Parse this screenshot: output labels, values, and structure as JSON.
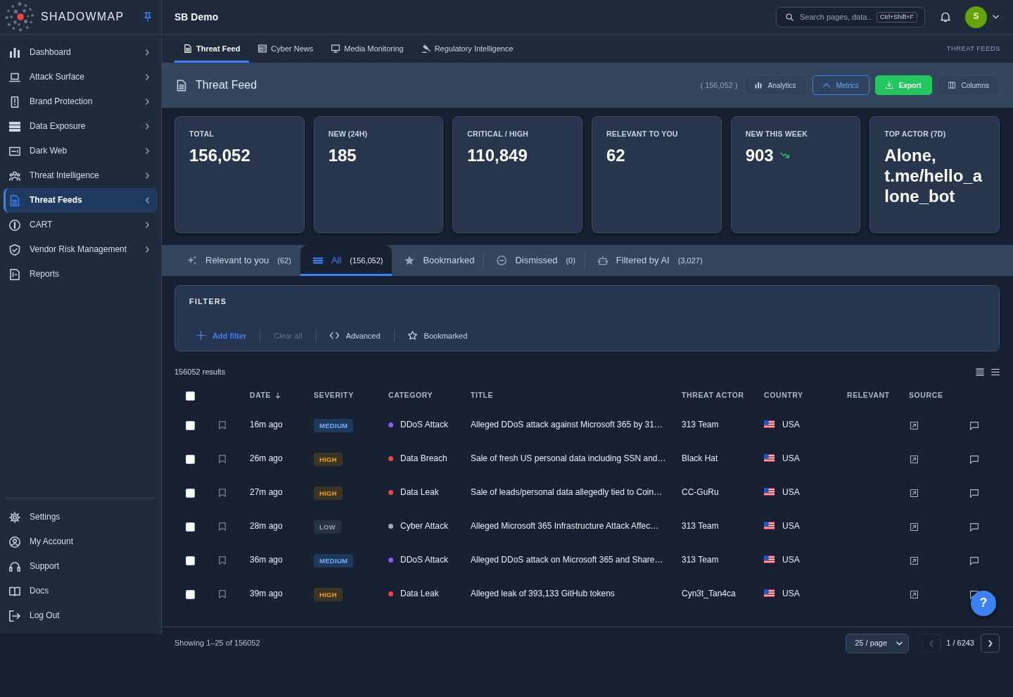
{
  "sidebar": {
    "brand": "SHADOWMAP",
    "items": [
      {
        "label": "Dashboard",
        "kind": "group",
        "selected": false,
        "expanded": false
      },
      {
        "label": "Attack Surface",
        "kind": "group",
        "selected": false,
        "expanded": false
      },
      {
        "label": "Brand Protection",
        "kind": "group",
        "selected": false,
        "expanded": false
      },
      {
        "label": "Data Exposure",
        "kind": "group",
        "selected": false,
        "expanded": false
      },
      {
        "label": "Dark Web",
        "kind": "group",
        "selected": false,
        "expanded": false
      },
      {
        "label": "Threat Intelligence",
        "kind": "group",
        "selected": false,
        "expanded": false
      },
      {
        "label": "Threat Feeds",
        "kind": "group",
        "selected": true,
        "expanded": true
      },
      {
        "label": "CART",
        "kind": "group",
        "selected": false,
        "expanded": false
      },
      {
        "label": "Vendor Risk Management",
        "kind": "group",
        "selected": false,
        "expanded": false
      },
      {
        "label": "Reports",
        "kind": "link",
        "selected": false
      }
    ],
    "footer_items": [
      "Settings",
      "My Account",
      "Support",
      "Docs",
      "Log Out"
    ]
  },
  "header": {
    "workspace": "SB Demo",
    "search": {
      "placeholder": "Search pages, data...",
      "shortcut": "Ctrl+Shift+F"
    },
    "avatar": "S"
  },
  "nav_tabs": [
    {
      "label": "Threat Feed",
      "selected": true
    },
    {
      "label": "Cyber News",
      "selected": false
    },
    {
      "label": "Media Monitoring",
      "selected": false
    },
    {
      "label": "Regulatory Intelligence",
      "selected": false
    }
  ],
  "breadcrumb": "THREAT FEEDS",
  "page_header": {
    "title": "Threat Feed",
    "count": "( 156,052 )",
    "buttons": [
      {
        "label": "Analytics",
        "kind": "ghost"
      },
      {
        "label": "Metrics",
        "kind": "outline"
      },
      {
        "label": "Export",
        "kind": "success"
      },
      {
        "label": "Columns",
        "kind": "ghost"
      }
    ]
  },
  "stats": [
    {
      "label": "TOTAL",
      "value": "156,052",
      "kind": "plain"
    },
    {
      "label": "NEW (24H)",
      "value": "185",
      "kind": "plain"
    },
    {
      "label": "CRITICAL / HIGH",
      "value": "110,849",
      "kind": "plain"
    },
    {
      "label": "RELEVANT TO YOU",
      "value": "62",
      "kind": "plain"
    },
    {
      "label": "NEW THIS WEEK",
      "value": "903",
      "kind": "trend"
    },
    {
      "label": "TOP ACTOR (7D)",
      "value": "Alone, t.me/hello_alone_bot",
      "kind": "plain"
    }
  ],
  "feed_tabs": [
    {
      "label": "Relevant to you",
      "count": "(62)",
      "selected": false
    },
    {
      "label": "All",
      "count": "(156,052)",
      "selected": true
    },
    {
      "label": "Bookmarked",
      "selected": false
    },
    {
      "label": "Dismissed",
      "count": "(0)",
      "selected": false
    },
    {
      "label": "Filtered by AI",
      "count": "(3,027)",
      "selected": false
    }
  ],
  "filters": {
    "title": "FILTERS",
    "actions": [
      {
        "label": "Add filter",
        "kind": "add",
        "disabled": false
      },
      {
        "label": "Clear all",
        "kind": "plain",
        "disabled": true
      },
      {
        "label": "Advanced",
        "kind": "code",
        "disabled": false
      },
      {
        "label": "Bookmarked",
        "kind": "star",
        "disabled": false
      }
    ]
  },
  "results": "156052 results",
  "table": {
    "select_all": {
      "checked": false
    },
    "columns": [
      {
        "label": "DATE",
        "sorted": true
      },
      {
        "label": "SEVERITY",
        "sorted": false
      },
      {
        "label": "CATEGORY",
        "sorted": false
      },
      {
        "label": "TITLE",
        "sorted": false
      },
      {
        "label": "THREAT ACTOR",
        "sorted": false
      },
      {
        "label": "COUNTRY",
        "sorted": false
      },
      {
        "label": "RELEVANT",
        "sorted": false
      },
      {
        "label": "SOURCE",
        "sorted": false
      }
    ],
    "rows": [
      {
        "checked": false,
        "bookmarked": false,
        "date": "16m ago",
        "severity": {
          "text": "MEDIUM",
          "kind": "medium"
        },
        "category": {
          "text": "DDoS Attack",
          "color": "#8b5cf6"
        },
        "title": "Alleged DDoS attack against Microsoft 365 by 31…",
        "threat_actor": "313 Team",
        "country": "USA"
      },
      {
        "checked": false,
        "bookmarked": false,
        "date": "26m ago",
        "severity": {
          "text": "HIGH",
          "kind": "high"
        },
        "category": {
          "text": "Data Breach",
          "color": "#ef4444"
        },
        "title": "Sale of fresh US personal data including SSN and…",
        "threat_actor": "Black Hat",
        "country": "USA"
      },
      {
        "checked": false,
        "bookmarked": false,
        "date": "27m ago",
        "severity": {
          "text": "HIGH",
          "kind": "high"
        },
        "category": {
          "text": "Data Leak",
          "color": "#ef4444"
        },
        "title": "Sale of leads/personal data allegedly tied to Coin…",
        "threat_actor": "CC-GuRu",
        "country": "USA"
      },
      {
        "checked": false,
        "bookmarked": false,
        "date": "28m ago",
        "severity": {
          "text": "LOW",
          "kind": "low"
        },
        "category": {
          "text": "Cyber Attack",
          "color": "#a3aab5"
        },
        "title": "Alleged Microsoft 365 Infrastructure Attack Affec…",
        "threat_actor": "313 Team",
        "country": "USA"
      },
      {
        "checked": false,
        "bookmarked": false,
        "date": "36m ago",
        "severity": {
          "text": "MEDIUM",
          "kind": "medium"
        },
        "category": {
          "text": "DDoS Attack",
          "color": "#8b5cf6"
        },
        "title": "Alleged DDoS attack on Microsoft 365 and Share…",
        "threat_actor": "313 Team",
        "country": "USA"
      },
      {
        "checked": false,
        "bookmarked": false,
        "date": "39m ago",
        "severity": {
          "text": "HIGH",
          "kind": "high"
        },
        "category": {
          "text": "Data Leak",
          "color": "#ef4444"
        },
        "title": "Alleged leak of 393,133 GitHub tokens",
        "threat_actor": "Cyn3t_Tan4ca",
        "country": "USA"
      }
    ]
  },
  "pagination": {
    "summary": "Showing 1–25 of 156052",
    "page_size": "25 / page",
    "page": "1 / 6243",
    "prev": {
      "disabled": true
    },
    "next": {
      "disabled": false
    }
  },
  "help_button": "?"
}
